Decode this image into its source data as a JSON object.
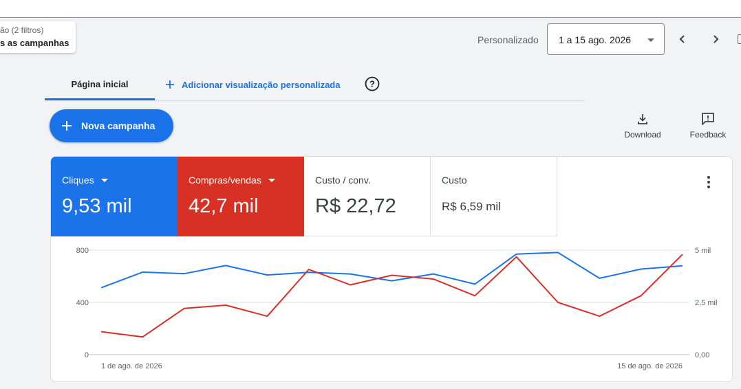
{
  "filter": {
    "line1": "ão (2 filtros)",
    "line2": "s as campanhas"
  },
  "date": {
    "label": "Personalizado",
    "value": "1 a 15 ago. 2026"
  },
  "tabs": {
    "home": "Página inicial",
    "add_view": "Adicionar visualização personalizada"
  },
  "new_campaign": "Nova campanha",
  "actions": {
    "download": "Download",
    "feedback": "Feedback"
  },
  "metrics": [
    {
      "label": "Cliques",
      "value": "9,53 mil",
      "color": "#1a73e8"
    },
    {
      "label": "Compras/vendas",
      "value": "42,7 mil",
      "color": "#d93025"
    },
    {
      "label": "Custo / conv.",
      "value": "R$ 22,72"
    },
    {
      "label": "Custo",
      "value": "R$ 6,59 mil"
    }
  ],
  "chart_data": {
    "type": "line",
    "x": [
      "1 de ago. de 2026",
      "2",
      "3",
      "4",
      "5",
      "6",
      "7",
      "8",
      "9",
      "10",
      "11",
      "12",
      "13",
      "14",
      "15 de ago. de 2026"
    ],
    "x_tick_labels": [
      "1 de ago. de 2026",
      "15 de ago. de 2026"
    ],
    "y_left": {
      "ticks": [
        "0",
        "400",
        "800"
      ],
      "range": [
        0,
        800
      ]
    },
    "y_right": {
      "ticks": [
        "0,00",
        "2,5 mil",
        "5 mil"
      ],
      "range": [
        0,
        5000
      ]
    },
    "grid": true,
    "series": [
      {
        "name": "Cliques",
        "axis": "left",
        "color": "#1a73e8",
        "values": [
          512,
          632,
          620,
          682,
          610,
          630,
          618,
          565,
          618,
          540,
          770,
          782,
          585,
          655,
          680
        ]
      },
      {
        "name": "Compras/vendas",
        "axis": "right",
        "color": "#d93025",
        "values": [
          1100,
          850,
          2210,
          2370,
          1840,
          4080,
          3340,
          3800,
          3620,
          2820,
          4680,
          2500,
          1840,
          2820,
          4800
        ]
      }
    ]
  }
}
